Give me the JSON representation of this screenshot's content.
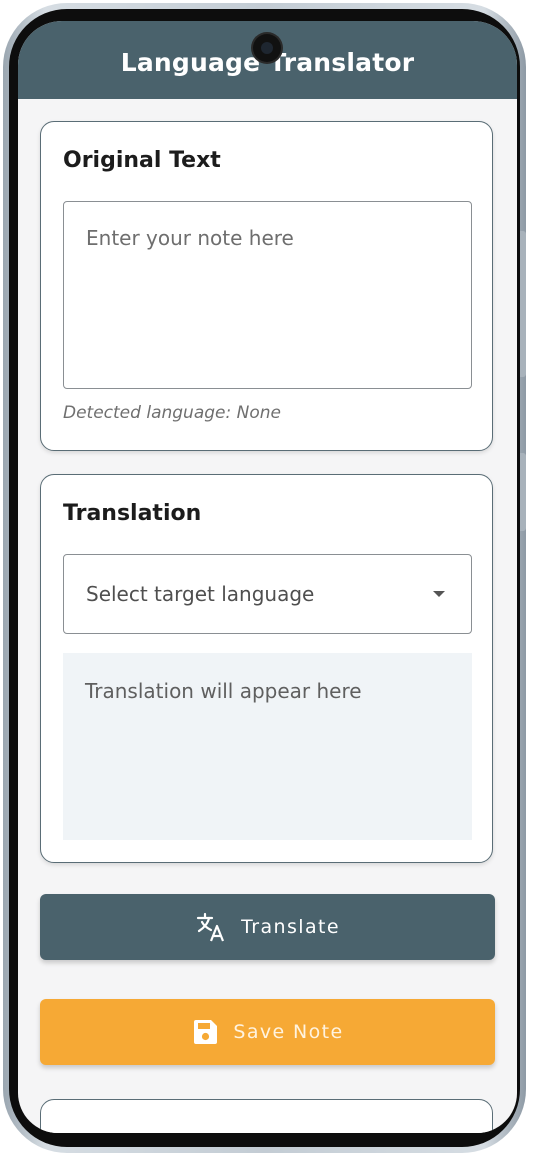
{
  "app": {
    "title": "Language Translator"
  },
  "original_card": {
    "title": "Original Text",
    "input_placeholder": "Enter your note here",
    "detected_language": "Detected language: None"
  },
  "translation_card": {
    "title": "Translation",
    "select_placeholder": "Select target language",
    "output_placeholder": "Translation will appear here"
  },
  "actions": {
    "translate_label": "Translate",
    "translate_icon": "translate-icon",
    "save_label": "Save Note",
    "save_icon": "save-icon"
  },
  "colors": {
    "primary": "#4a626c",
    "accent": "#f6a935",
    "output_background": "#f0f4f7"
  }
}
